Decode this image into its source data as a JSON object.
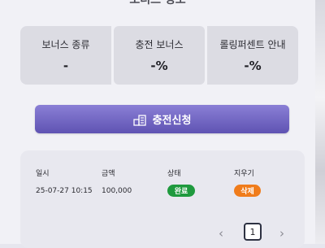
{
  "section_title": "보너스 정보",
  "stats": [
    {
      "label": "보너스 종류",
      "value": "-"
    },
    {
      "label": "충전 보너스",
      "value": "-%"
    },
    {
      "label": "롤링퍼센트 안내",
      "value": "-%"
    }
  ],
  "charge_button": {
    "label": "충전신청",
    "icon": "charge-request-icon"
  },
  "table": {
    "headers": [
      "일시",
      "금액",
      "상태",
      "지우기"
    ],
    "rows": [
      {
        "datetime": "25-07-27 10:15",
        "amount": "100,000",
        "status": "완료",
        "action": "삭제"
      }
    ]
  },
  "pagination": {
    "prev": "‹",
    "current": "1",
    "next": "›"
  },
  "colors": {
    "button_top": "#8a7fd6",
    "button_bottom": "#5f53b3",
    "status_done": "#1f9a3e",
    "delete": "#f07c1b"
  }
}
